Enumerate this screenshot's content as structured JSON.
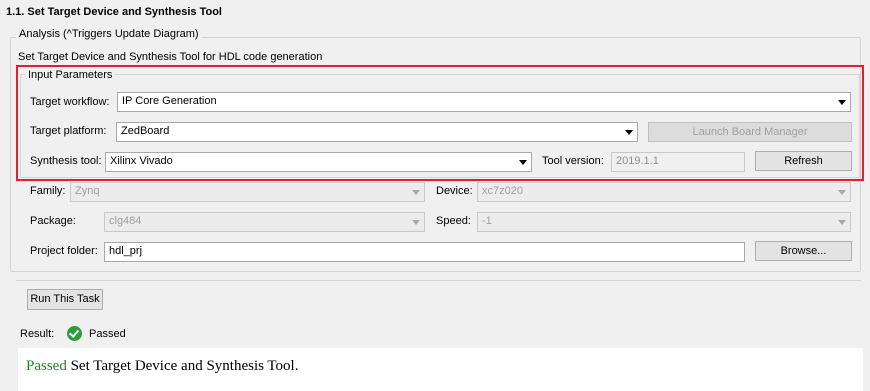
{
  "title": "1.1. Set Target Device and Synthesis Tool",
  "analysis_label": "Analysis (^Triggers Update Diagram)",
  "description": "Set Target Device and Synthesis Tool for HDL code generation",
  "input_parameters": {
    "legend": "Input Parameters",
    "target_workflow": {
      "label": "Target workflow:",
      "value": "IP Core Generation"
    },
    "target_platform": {
      "label": "Target platform:",
      "value": "ZedBoard"
    },
    "launch_board_manager": "Launch Board Manager",
    "synthesis_tool": {
      "label": "Synthesis tool:",
      "value": "Xilinx Vivado"
    },
    "tool_version": {
      "label": "Tool version:",
      "value": "2019.1.1"
    },
    "refresh": "Refresh"
  },
  "device": {
    "family": {
      "label": "Family:",
      "value": "Zynq"
    },
    "device": {
      "label": "Device:",
      "value": "xc7z020"
    },
    "package": {
      "label": "Package:",
      "value": "clg484"
    },
    "speed": {
      "label": "Speed:",
      "value": "-1"
    },
    "project_folder": {
      "label": "Project folder:",
      "value": "hdl_prj"
    },
    "browse": "Browse..."
  },
  "run_task": "Run This Task",
  "result": {
    "label": "Result:",
    "status": "Passed",
    "message_status": "Passed",
    "message_text": " Set Target Device and Synthesis Tool."
  },
  "colors": {
    "highlight_border": "#e0202c",
    "passed_green": "#1b8a1b"
  }
}
